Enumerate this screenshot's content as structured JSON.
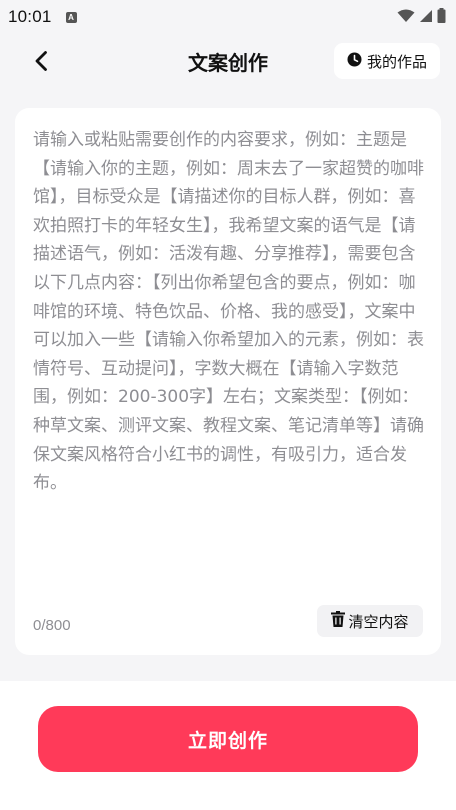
{
  "status_bar": {
    "time": "10:01",
    "notification_glyph": "A",
    "icons": [
      "wifi-icon",
      "signal-icon",
      "battery-icon"
    ]
  },
  "header": {
    "title": "文案创作",
    "back_icon": "chevron-left-icon",
    "my_works_label": "我的作品",
    "my_works_icon": "clock-icon"
  },
  "editor": {
    "placeholder": "请输入或粘贴需要创作的内容要求，例如：主题是【请输入你的主题，例如：周末去了一家超赞的咖啡馆】，目标受众是【请描述你的目标人群，例如：喜欢拍照打卡的年轻女生】，我希望文案的语气是【请描述语气，例如：活泼有趣、分享推荐】，需要包含以下几点内容：【列出你希望包含的要点，例如：咖啡馆的环境、特色饮品、价格、我的感受】，文案中可以加入一些【请输入你希望加入的元素，例如：表情符号、互动提问】，字数大概在【请输入字数范围，例如：200-300字】左右；文案类型：【例如：种草文案、测评文案、教程文案、笔记清单等】请确保文案风格符合小红书的调性，有吸引力，适合发布。",
    "char_count": "0/800",
    "clear_label": "清空内容",
    "clear_icon": "trash-icon"
  },
  "footer": {
    "create_label": "立即创作"
  },
  "colors": {
    "accent": "#ff3a59",
    "background": "#f5f5f7",
    "card": "#ffffff",
    "placeholder_text": "#8e8e93"
  }
}
